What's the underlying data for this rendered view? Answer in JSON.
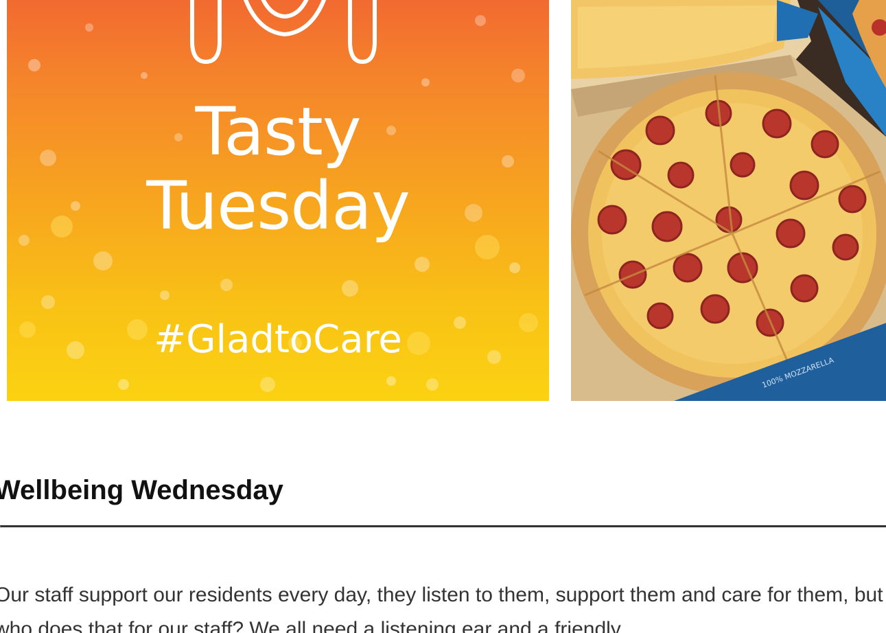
{
  "promo": {
    "title_line1": "Tasty",
    "title_line2": "Tuesday",
    "hashtag": "#GladtoCare",
    "icon": "plate-cutlery-icon",
    "colors": {
      "gradient_top": "#f26a30",
      "gradient_bottom": "#fbd212",
      "text": "#ffffff"
    }
  },
  "photo": {
    "subject": "pepperoni pizzas in delivery boxes",
    "box_print": "100% MOZZARELLA"
  },
  "article": {
    "heading": "Wellbeing Wednesday",
    "body": "Our staff support our residents every day, they listen to them, support them and care for them, but who does that for our staff? We all need a listening ear and a friendly"
  }
}
